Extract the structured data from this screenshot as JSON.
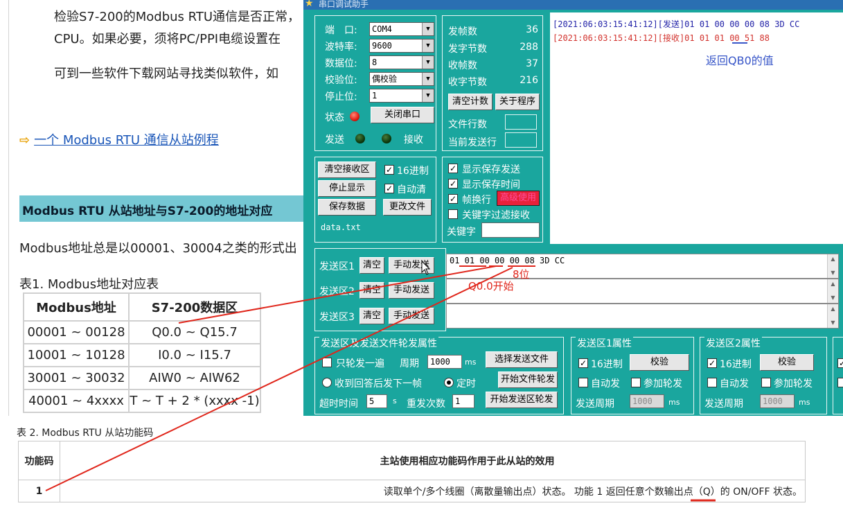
{
  "doc": {
    "line1": "检验S7-200的Modbus RTU通信是否正常，",
    "line2": "CPU。如果必要，须将PC/PPI电缆设置在",
    "line3": "可到一些软件下载网站寻找类似软件，如",
    "link_arrow": "⇨",
    "link": "一个 Modbus RTU 通信从站例程",
    "section_title": "Modbus RTU 从站地址与S7-200的地址对应",
    "line4": "Modbus地址总是以00001、30004之类的形式出",
    "table1_caption": "表1. Modbus地址对应表",
    "table1": {
      "headers": [
        "Modbus地址",
        "S7-200数据区"
      ],
      "rows": [
        [
          "00001 ~ 00128",
          "Q0.0 ~ Q15.7"
        ],
        [
          "10001 ~ 10128",
          "I0.0 ~ I15.7"
        ],
        [
          "30001 ~ 30032",
          "AIW0 ~ AIW62"
        ],
        [
          "40001 ~ 4xxxx",
          "T ~ T + 2 * (xxxx -1)"
        ]
      ]
    },
    "table2_caption": "表 2. Modbus RTU 从站功能码",
    "table2": {
      "header_col1": "功能码",
      "header_col2": "主站使用相应功能码作用于此从站的效用",
      "row1_col1": "1",
      "row1_col2": "读取单个/多个线圈（离散量输出点）状态。 功能 1 返回任意个数输出点（Q）的 ON/OFF 状态。"
    }
  },
  "tool": {
    "title": "串口调试助手",
    "port": {
      "label": "端　口:",
      "value": "COM4"
    },
    "baud": {
      "label": "波特率:",
      "value": "9600"
    },
    "databits": {
      "label": "数据位:",
      "value": "8"
    },
    "parity": {
      "label": "校验位:",
      "value": "偶校验"
    },
    "stopbits": {
      "label": "停止位:",
      "value": "1"
    },
    "status_label": "状态",
    "close_port": "关闭串口",
    "send_label": "发送",
    "recv_label": "接收",
    "stats": {
      "tx_frames_label": "发帧数",
      "tx_frames": "36",
      "tx_bytes_label": "发字节数",
      "tx_bytes": "288",
      "rx_frames_label": "收帧数",
      "rx_frames": "37",
      "rx_bytes_label": "收字节数",
      "rx_bytes": "216"
    },
    "clear_count": "清空计数",
    "about": "关于程序",
    "file_lines_label": "文件行数",
    "current_line_label": "当前发送行",
    "recv_area": {
      "clear_btn": "清空接收区",
      "stop_btn": "停止显示",
      "save_btn": "保存数据",
      "change_file_btn": "更改文件",
      "hex_label": "16进制",
      "auto_clear_label": "自动清",
      "filename": "data.txt"
    },
    "options": {
      "show_save_send": "显示保存发送",
      "show_save_time": "显示保存时间",
      "frame_wrap": "帧换行",
      "advanced": "高级使用",
      "keyword_filter": "关键字过滤接收",
      "keyword_label": "关键字"
    },
    "recv_lines": [
      {
        "time": "[2021:06:03:15:41:12]",
        "tag": "[发送]",
        "data": "01 01 00 00 00 08 3D CC"
      },
      {
        "time": "[2021:06:03:15:41:12]",
        "tag": "[接收]",
        "data": "01 01 01 00 51 88"
      }
    ],
    "send_zones": [
      {
        "label": "发送区1",
        "clear": "清空",
        "send": "手动发送",
        "content": "01 01 00 00 00 08 3D CC"
      },
      {
        "label": "发送区2",
        "clear": "清空",
        "send": "手动发送",
        "content": ""
      },
      {
        "label": "发送区3",
        "clear": "清空",
        "send": "手动发送",
        "content": ""
      }
    ],
    "rotation": {
      "title": "发送区及发送文件轮发属性",
      "only_once": "只轮发一遍",
      "period_label": "周期",
      "period_value": "1000",
      "period_unit": "ms",
      "select_file": "选择发送文件",
      "after_reply": "收到回答后发下一帧",
      "timed": "定时",
      "start_file": "开始文件轮发",
      "timeout_label": "超时时间",
      "timeout_value": "5",
      "timeout_unit": "s",
      "retry_label": "重发次数",
      "retry_value": "1",
      "start_zone": "开始发送区轮发"
    },
    "zone1_props": {
      "title": "发送区1属性",
      "hex": "16进制",
      "checksum": "校验",
      "auto": "自动发",
      "join": "参加轮发",
      "period_label": "发送周期",
      "period_value": "1000",
      "unit": "ms"
    },
    "zone2_props": {
      "title": "发送区2属性",
      "hex": "16进制",
      "checksum": "校验",
      "auto": "自动发",
      "join": "参加轮发",
      "period_label": "发送周期",
      "period_value": "1000",
      "unit": "ms"
    }
  },
  "annotations": {
    "qb0": "返回QB0的值",
    "bits8": "8位",
    "q00start": "Q0.0开始"
  },
  "colors": {
    "tool_bg": "#1aa69e",
    "annotation_red": "#e0261b",
    "annotation_blue": "#3755c8",
    "recv_send_color": "#2323a8",
    "recv_recv_color": "#d2322d"
  }
}
